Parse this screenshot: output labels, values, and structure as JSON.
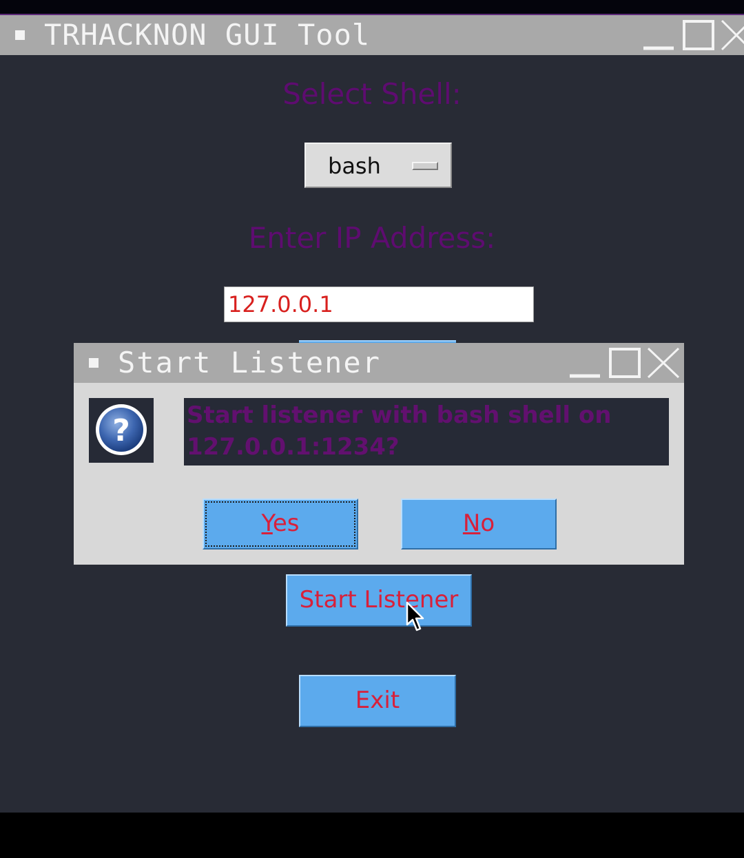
{
  "window": {
    "title": "TRHACKNON GUI Tool"
  },
  "form": {
    "shell_label": "Select Shell:",
    "shell_value": "bash",
    "ip_label": "Enter IP Address:",
    "ip_value": "127.0.0.1",
    "start_button": "Start Listener",
    "exit_button": "Exit"
  },
  "dialog": {
    "title": "Start Listener",
    "icon": "question-icon",
    "message_line1": "Start listener with bash shell on",
    "message_line2": "127.0.0.1:1234?",
    "yes_label_first": "Y",
    "yes_label_rest": "es",
    "no_label_first": "N",
    "no_label_rest": "o"
  },
  "colors": {
    "background": "#282b35",
    "titlebar": "#a9a9a9",
    "label_text": "#5e0c70",
    "button_bg": "#5caaed",
    "button_text": "#d8203a"
  }
}
